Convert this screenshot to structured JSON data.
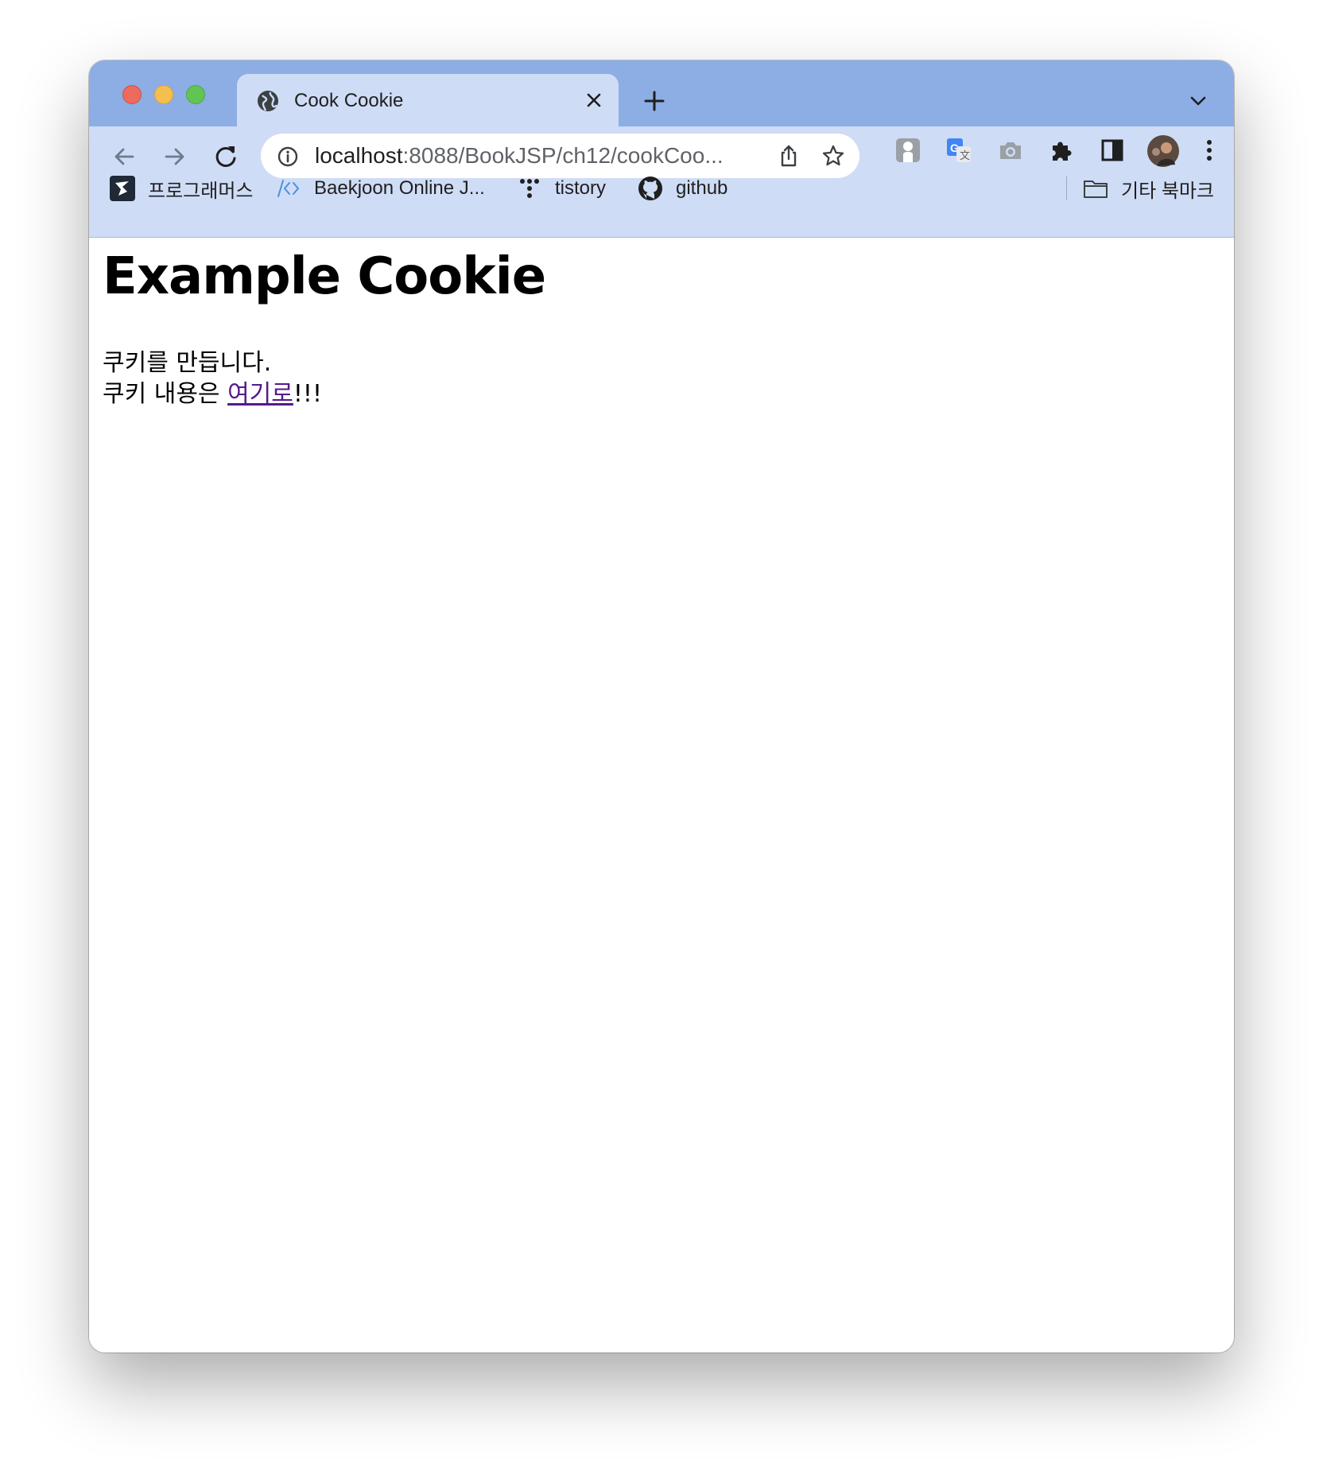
{
  "browser": {
    "tab": {
      "title": "Cook Cookie"
    },
    "omnibox": {
      "host": "localhost",
      "path": ":8088/BookJSP/ch12/cookCoo..."
    },
    "bookmarks": [
      {
        "label": "프로그래머스",
        "icon": "programmers-icon"
      },
      {
        "label": "Baekjoon Online J...",
        "icon": "code-brackets-icon"
      },
      {
        "label": "tistory",
        "icon": "tistory-icon"
      },
      {
        "label": "github",
        "icon": "github-icon"
      }
    ],
    "other_bookmarks": {
      "label": "기타 북마크",
      "icon": "folder-icon"
    },
    "colors": {
      "titlebar": "#8dade5",
      "toolbar": "#cfdcf5",
      "link": "#551a8b"
    }
  },
  "page": {
    "heading": "Example Cookie",
    "line1": "쿠키를 만듭니다.",
    "line2_prefix": "쿠키 내용은 ",
    "line2_link": "여기로",
    "line2_suffix": "!!!"
  }
}
